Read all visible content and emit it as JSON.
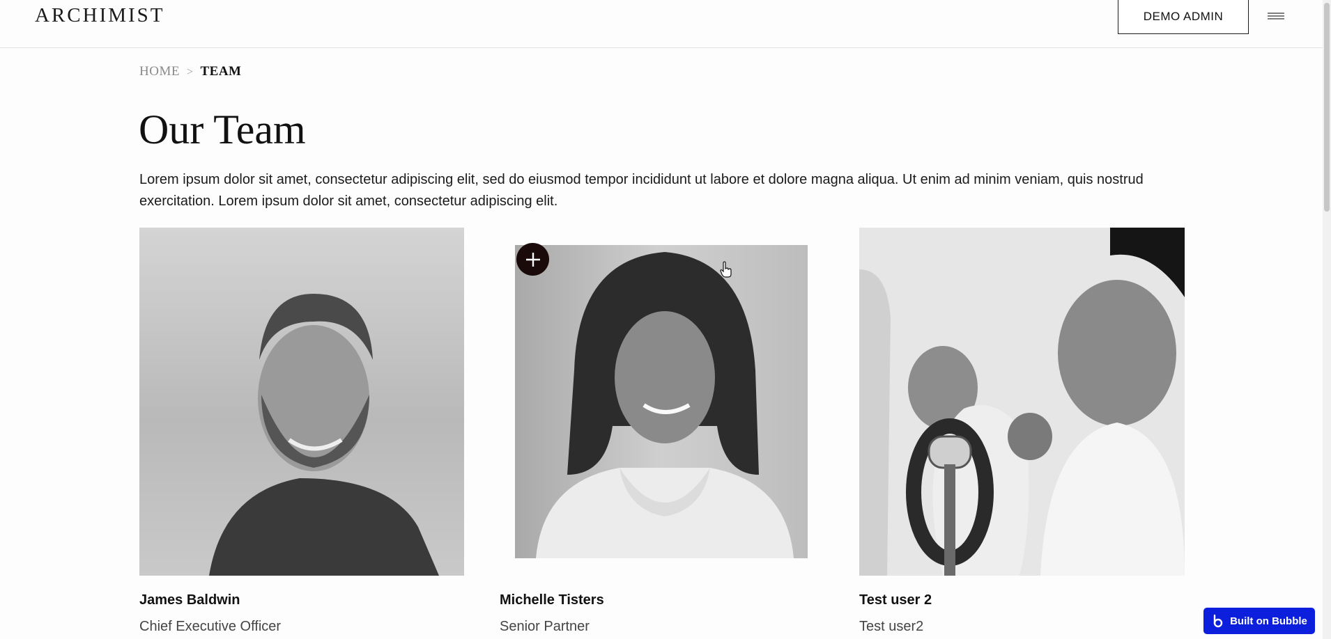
{
  "header": {
    "logo": "ARCHIMIST",
    "demo_button": "DEMO ADMIN",
    "menu_icon": "hamburger-icon"
  },
  "breadcrumb": {
    "home": "HOME",
    "separator": ">",
    "current": "TEAM"
  },
  "page": {
    "title": "Our Team",
    "intro": "Lorem ipsum dolor sit amet, consectetur adipiscing elit, sed do eiusmod tempor incididunt ut labore et dolore magna aliqua. Ut enim ad minim veniam, quis nostrud exercitation. Lorem ipsum dolor sit amet, consectetur adipiscing elit."
  },
  "team": [
    {
      "name": "James Baldwin",
      "role": "Chief Executive Officer"
    },
    {
      "name": "Michelle Tisters",
      "role": "Senior Partner"
    },
    {
      "name": "Test user 2",
      "role": "Test user2"
    }
  ],
  "badge": {
    "label": "Built on Bubble"
  },
  "colors": {
    "text": "#111111",
    "badge": "#0b1fdc",
    "add_button": "#1b0a0a",
    "photo_gray": "#cfcfcf"
  }
}
